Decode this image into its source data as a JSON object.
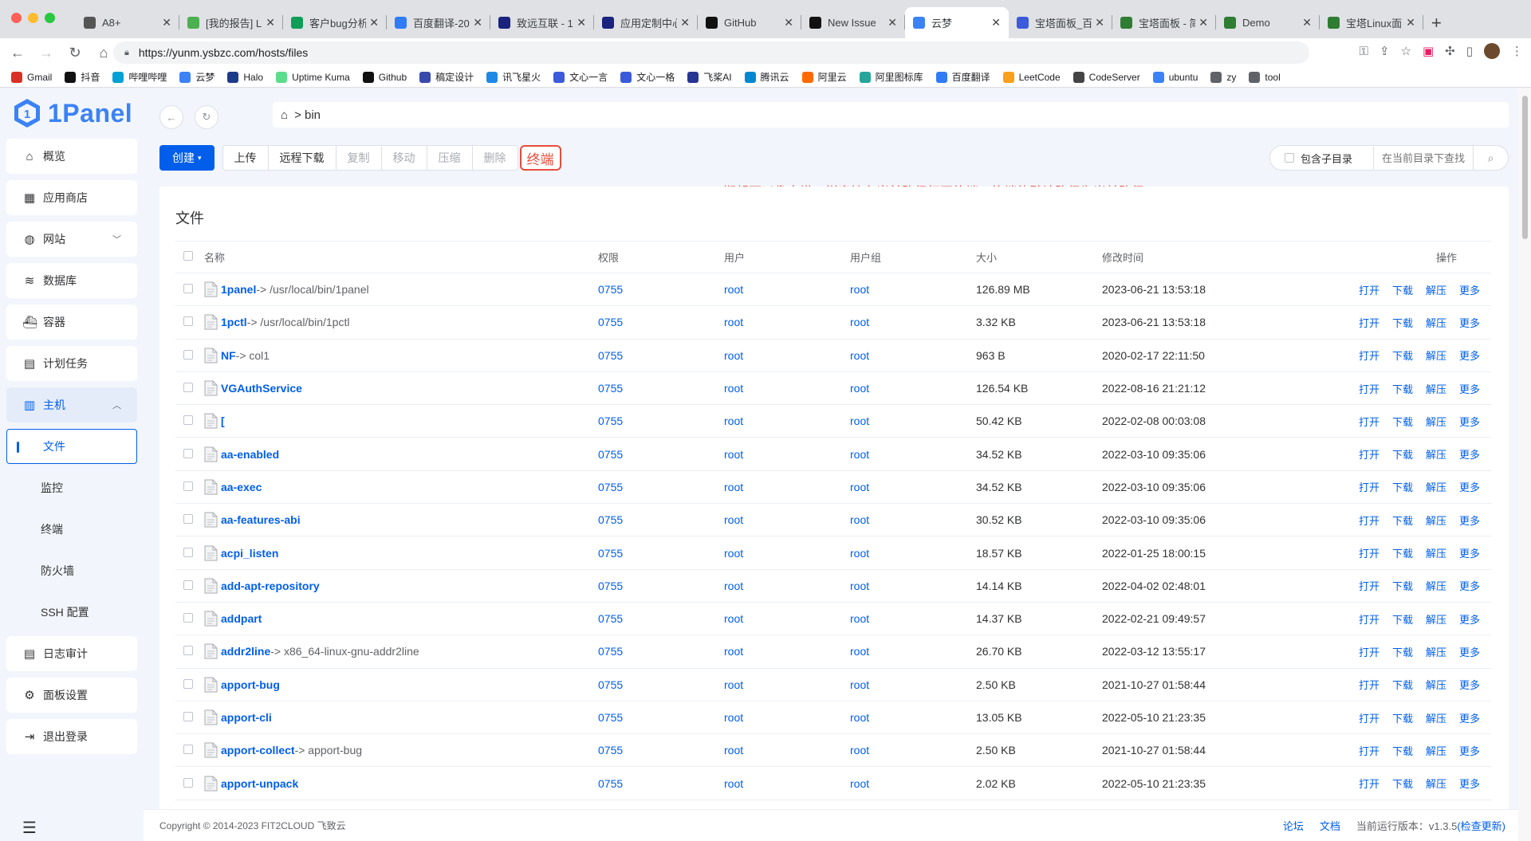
{
  "browser": {
    "tabs": [
      {
        "title": "A8+",
        "fav": "#555"
      },
      {
        "title": "[我的报告] L",
        "fav": "#4caf50"
      },
      {
        "title": "客户bug分析",
        "fav": "#0f9d58"
      },
      {
        "title": "百度翻译-20",
        "fav": "#2f7cf6"
      },
      {
        "title": "致远互联 - 1",
        "fav": "#1a237e"
      },
      {
        "title": "应用定制中心",
        "fav": "#1a237e"
      },
      {
        "title": "GitHub",
        "fav": "#111"
      },
      {
        "title": "New Issue",
        "fav": "#111"
      },
      {
        "title": "云梦",
        "fav": "#3b82f6",
        "active": true
      },
      {
        "title": "宝塔面板_百",
        "fav": "#3b5bdb"
      },
      {
        "title": "宝塔面板 - 简",
        "fav": "#2e7d32"
      },
      {
        "title": "Demo",
        "fav": "#2e7d32"
      },
      {
        "title": "宝塔Linux面",
        "fav": "#2e7d32"
      }
    ],
    "url": "https://yunm.ysbzc.com/hosts/files",
    "bookmarks": [
      {
        "label": "Gmail",
        "color": "#d93025"
      },
      {
        "label": "抖音",
        "color": "#111"
      },
      {
        "label": "哔哩哔哩",
        "color": "#00a1d6"
      },
      {
        "label": "云梦",
        "color": "#3b82f6"
      },
      {
        "label": "Halo",
        "color": "#1e3a8a"
      },
      {
        "label": "Uptime Kuma",
        "color": "#5cdd8b"
      },
      {
        "label": "Github",
        "color": "#111"
      },
      {
        "label": "稿定设计",
        "color": "#3949ab"
      },
      {
        "label": "讯飞星火",
        "color": "#1e88e5"
      },
      {
        "label": "文心一言",
        "color": "#3b5bdb"
      },
      {
        "label": "文心一格",
        "color": "#3b5bdb"
      },
      {
        "label": "飞桨AI",
        "color": "#283593"
      },
      {
        "label": "腾讯云",
        "color": "#0288d1"
      },
      {
        "label": "阿里云",
        "color": "#ff6a00"
      },
      {
        "label": "阿里图标库",
        "color": "#26a69a"
      },
      {
        "label": "百度翻译",
        "color": "#2f7cf6"
      },
      {
        "label": "LeetCode",
        "color": "#f89f1b"
      },
      {
        "label": "CodeServer",
        "color": "#444"
      },
      {
        "label": "ubuntu",
        "color": "#3b82f6"
      },
      {
        "label": "zy",
        "color": "#5f6368"
      },
      {
        "label": "tool",
        "color": "#5f6368"
      }
    ]
  },
  "app": {
    "logo_text": "1Panel",
    "menu": {
      "overview": "概览",
      "appstore": "应用商店",
      "website": "网站",
      "database": "数据库",
      "container": "容器",
      "cron": "计划任务",
      "host": "主机",
      "files": "文件",
      "monitor": "监控",
      "terminal": "终端",
      "firewall": "防火墙",
      "ssh": "SSH 配置",
      "logs": "日志审计",
      "settings": "面板设置",
      "logout": "退出登录"
    },
    "path": {
      "dir": "bin"
    },
    "toolbar": {
      "create": "创建",
      "upload": "上传",
      "remote_download": "远程下载",
      "copy": "复制",
      "move": "移动",
      "compress": "压缩",
      "delete": "删除",
      "terminal": "终端"
    },
    "search": {
      "include_sub": "包含子目录",
      "placeholder": "在当前目录下查找"
    },
    "annotation": "期望可以像宝塔一样直接在当前路径打开终端，终端的默认路径为当前路径",
    "card_title": "文件",
    "columns": {
      "name": "名称",
      "perm": "权限",
      "user": "用户",
      "group": "用户组",
      "size": "大小",
      "mtime": "修改时间",
      "ops": "操作"
    },
    "ops": {
      "open": "打开",
      "download": "下载",
      "extract": "解压",
      "more": "更多"
    },
    "files": [
      {
        "name": "1panel",
        "link": "-> /usr/local/bin/1panel",
        "perm": "0755",
        "user": "root",
        "group": "root",
        "size": "126.89 MB",
        "mtime": "2023-06-21 13:53:18"
      },
      {
        "name": "1pctl",
        "link": "-> /usr/local/bin/1pctl",
        "perm": "0755",
        "user": "root",
        "group": "root",
        "size": "3.32 KB",
        "mtime": "2023-06-21 13:53:18"
      },
      {
        "name": "NF",
        "link": "-> col1",
        "perm": "0755",
        "user": "root",
        "group": "root",
        "size": "963 B",
        "mtime": "2020-02-17 22:11:50"
      },
      {
        "name": "VGAuthService",
        "link": "",
        "perm": "0755",
        "user": "root",
        "group": "root",
        "size": "126.54 KB",
        "mtime": "2022-08-16 21:21:12"
      },
      {
        "name": "[",
        "link": "",
        "perm": "0755",
        "user": "root",
        "group": "root",
        "size": "50.42 KB",
        "mtime": "2022-02-08 00:03:08"
      },
      {
        "name": "aa-enabled",
        "link": "",
        "perm": "0755",
        "user": "root",
        "group": "root",
        "size": "34.52 KB",
        "mtime": "2022-03-10 09:35:06"
      },
      {
        "name": "aa-exec",
        "link": "",
        "perm": "0755",
        "user": "root",
        "group": "root",
        "size": "34.52 KB",
        "mtime": "2022-03-10 09:35:06"
      },
      {
        "name": "aa-features-abi",
        "link": "",
        "perm": "0755",
        "user": "root",
        "group": "root",
        "size": "30.52 KB",
        "mtime": "2022-03-10 09:35:06"
      },
      {
        "name": "acpi_listen",
        "link": "",
        "perm": "0755",
        "user": "root",
        "group": "root",
        "size": "18.57 KB",
        "mtime": "2022-01-25 18:00:15"
      },
      {
        "name": "add-apt-repository",
        "link": "",
        "perm": "0755",
        "user": "root",
        "group": "root",
        "size": "14.14 KB",
        "mtime": "2022-04-02 02:48:01"
      },
      {
        "name": "addpart",
        "link": "",
        "perm": "0755",
        "user": "root",
        "group": "root",
        "size": "14.37 KB",
        "mtime": "2022-02-21 09:49:57"
      },
      {
        "name": "addr2line",
        "link": "-> x86_64-linux-gnu-addr2line",
        "perm": "0755",
        "user": "root",
        "group": "root",
        "size": "26.70 KB",
        "mtime": "2022-03-12 13:55:17"
      },
      {
        "name": "apport-bug",
        "link": "",
        "perm": "0755",
        "user": "root",
        "group": "root",
        "size": "2.50 KB",
        "mtime": "2021-10-27 01:58:44"
      },
      {
        "name": "apport-cli",
        "link": "",
        "perm": "0755",
        "user": "root",
        "group": "root",
        "size": "13.05 KB",
        "mtime": "2022-05-10 21:23:35"
      },
      {
        "name": "apport-collect",
        "link": "-> apport-bug",
        "perm": "0755",
        "user": "root",
        "group": "root",
        "size": "2.50 KB",
        "mtime": "2021-10-27 01:58:44"
      },
      {
        "name": "apport-unpack",
        "link": "",
        "perm": "0755",
        "user": "root",
        "group": "root",
        "size": "2.02 KB",
        "mtime": "2022-05-10 21:23:35"
      }
    ],
    "footer": {
      "copyright": "Copyright © 2014-2023 FIT2CLOUD 飞致云",
      "forum": "论坛",
      "docs": "文档",
      "version": "当前运行版本：v1.3.5",
      "check_update": "(检查更新)"
    }
  }
}
